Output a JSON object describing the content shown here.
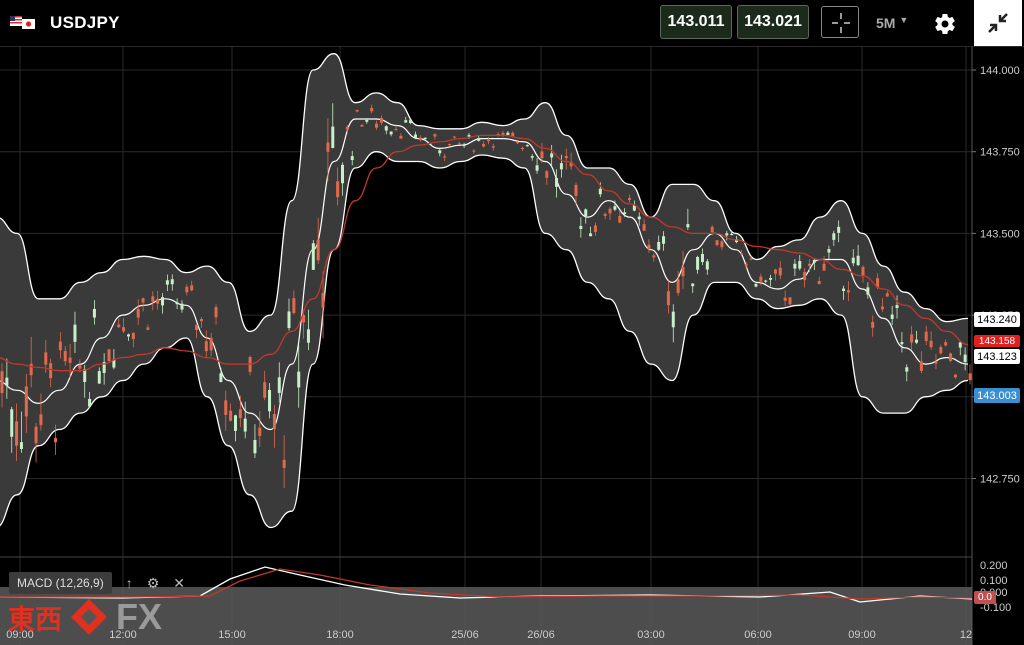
{
  "header": {
    "symbol": "USDJPY",
    "bid": "143.011",
    "ask": "143.021",
    "timeframe": "5M"
  },
  "price_axis": [
    "144.000",
    "143.750",
    "143.500",
    "143.250",
    "143.000",
    "142.750"
  ],
  "macd_axis": [
    "0.200",
    "0.100",
    "0.000",
    "-0.100"
  ],
  "time_axis": [
    "09:00",
    "12:00",
    "15:00",
    "18:00",
    "25/06",
    "26/06",
    "03:00",
    "06:00",
    "09:00",
    "12"
  ],
  "badges": {
    "upper_band": "143.240",
    "sma": "143.158",
    "middle_band": "143.123",
    "last": "143.003",
    "macd": "0.0"
  },
  "macd": {
    "label": "MACD (12,26,9)"
  },
  "logo": {
    "kanji": "東西",
    "fx": "FX"
  },
  "colors": {
    "bull": "#c8f0c8",
    "bear": "#e26a4a",
    "sma": "#c0392b",
    "band": "#ffffff",
    "band_fill": "#3a3a3a",
    "last_badge": "#3a8fd0",
    "sma_badge": "#e02020"
  },
  "icons": [
    "flag-icon",
    "crosshair-icon",
    "dropdown-arrow-icon",
    "gear-icon",
    "collapse-icon",
    "arrow-up-icon",
    "settings-icon",
    "close-icon"
  ],
  "chart_data": {
    "type": "candlestick",
    "ylim": [
      142.6,
      144.05
    ],
    "series": [
      {
        "name": "middle",
        "values": [
          143.05,
          143.02,
          142.98,
          143.02,
          143.1,
          143.18,
          143.25,
          143.28,
          143.3,
          143.28,
          143.18,
          143.05,
          142.95,
          142.9,
          143.1,
          143.45,
          143.72,
          143.85,
          143.85,
          143.83,
          143.79,
          143.76,
          143.77,
          143.79,
          143.79,
          143.78,
          143.72,
          143.62,
          143.55,
          143.6,
          143.55,
          143.45,
          143.35,
          143.45,
          143.5,
          143.45,
          143.35,
          143.33,
          143.36,
          143.42,
          143.42,
          143.33,
          143.24,
          143.15,
          143.1,
          143.12,
          143.1
        ]
      },
      {
        "name": "upper",
        "values": [
          143.55,
          143.5,
          143.3,
          143.3,
          143.35,
          143.38,
          143.42,
          143.43,
          143.42,
          143.38,
          143.4,
          143.35,
          143.2,
          143.25,
          143.6,
          144.0,
          144.05,
          143.9,
          143.93,
          143.9,
          143.83,
          143.82,
          143.82,
          143.84,
          143.83,
          143.85,
          143.9,
          143.8,
          143.7,
          143.7,
          143.65,
          143.55,
          143.65,
          143.65,
          143.6,
          143.5,
          143.42,
          143.46,
          143.48,
          143.55,
          143.6,
          143.5,
          143.4,
          143.32,
          143.27,
          143.23,
          143.24
        ]
      },
      {
        "name": "lower",
        "values": [
          142.6,
          142.7,
          142.85,
          142.9,
          142.95,
          143.0,
          143.05,
          143.1,
          143.15,
          143.18,
          143.0,
          142.85,
          142.7,
          142.6,
          142.65,
          143.1,
          143.45,
          143.7,
          143.75,
          143.72,
          143.72,
          143.7,
          143.72,
          143.74,
          143.73,
          143.7,
          143.5,
          143.45,
          143.35,
          143.3,
          143.2,
          143.1,
          143.05,
          143.25,
          143.35,
          143.35,
          143.3,
          143.27,
          143.28,
          143.3,
          143.25,
          143.0,
          142.95,
          142.95,
          143.0,
          143.02,
          143.05
        ]
      },
      {
        "name": "sma",
        "values": [
          143.12,
          143.1,
          143.09,
          143.08,
          143.08,
          143.1,
          143.12,
          143.13,
          143.15,
          143.14,
          143.12,
          143.1,
          143.1,
          143.13,
          143.2,
          143.3,
          143.45,
          143.6,
          143.7,
          143.75,
          143.77,
          143.78,
          143.79,
          143.8,
          143.8,
          143.79,
          143.76,
          143.72,
          143.68,
          143.63,
          143.59,
          143.55,
          143.52,
          143.5,
          143.5,
          143.48,
          143.46,
          143.45,
          143.44,
          143.42,
          143.39,
          143.37,
          143.33,
          143.28,
          143.24,
          143.2,
          143.16
        ]
      }
    ]
  }
}
